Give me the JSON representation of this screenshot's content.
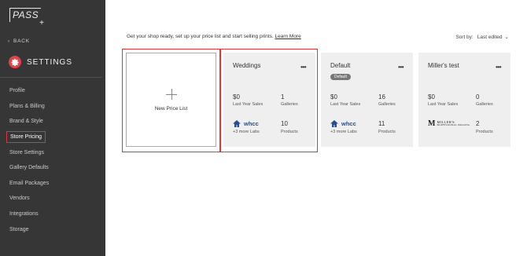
{
  "sidebar": {
    "logo_text": "PASS",
    "logo_plus": "+",
    "back_label": "BACK",
    "settings_title": "SETTINGS",
    "items": [
      {
        "label": "Profile"
      },
      {
        "label": "Plans & Billing"
      },
      {
        "label": "Brand & Style"
      },
      {
        "label": "Store Pricing"
      },
      {
        "label": "Store Settings"
      },
      {
        "label": "Gallery Defaults"
      },
      {
        "label": "Email Packages"
      },
      {
        "label": "Vendors"
      },
      {
        "label": "Integrations"
      },
      {
        "label": "Storage"
      }
    ],
    "active_item": "Store Pricing"
  },
  "header": {
    "intro_text": "Get your shop ready, set up your price list and start selling prints.",
    "learn_more": "Learn More",
    "sort_label": "Sort by:",
    "sort_value": "Last edited"
  },
  "new_card": {
    "label": "New Price List"
  },
  "cards": [
    {
      "title": "Weddings",
      "badge": "",
      "sales": "$0",
      "sales_label": "Last Year Sales",
      "galleries": "1",
      "galleries_label": "Galleries",
      "lab": "whcc",
      "more_labs": "+3 more Labs",
      "products": "10",
      "products_label": "Products"
    },
    {
      "title": "Default",
      "badge": "Default",
      "sales": "$0",
      "sales_label": "Last Year Sales",
      "galleries": "16",
      "galleries_label": "Galleries",
      "lab": "whcc",
      "more_labs": "+3 more Labs",
      "products": "11",
      "products_label": "Products"
    },
    {
      "title": "Miller's test",
      "badge": "",
      "sales": "$0",
      "sales_label": "Last Year Sales",
      "galleries": "0",
      "galleries_label": "Galleries",
      "lab_name": "MILLER'S",
      "lab_sub": "PROFESSIONAL IMAGING",
      "products": "2",
      "products_label": "Products"
    }
  ],
  "colors": {
    "sidebar_bg": "#363636",
    "accent": "#e0444d",
    "highlight": "#d9383a",
    "card_bg": "#efefef",
    "whcc_blue": "#2a4d8f"
  }
}
